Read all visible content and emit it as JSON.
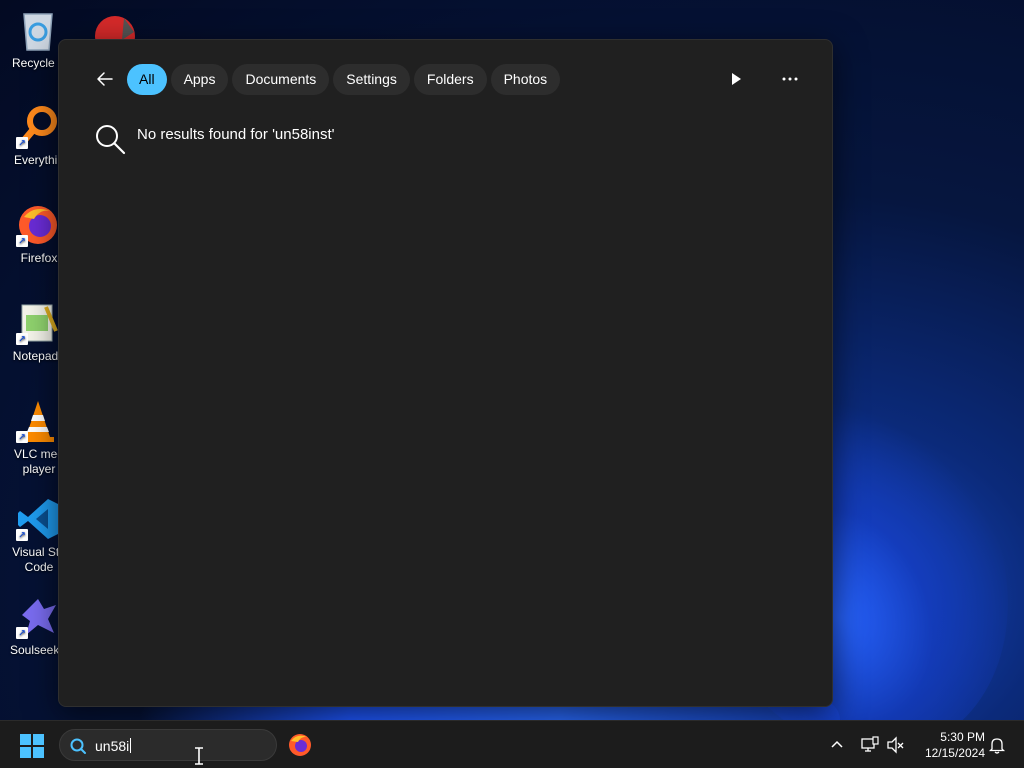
{
  "desktop": {
    "icons": [
      {
        "name": "recycle-bin",
        "label": "Recycle B"
      },
      {
        "name": "everything",
        "label": "Everythin"
      },
      {
        "name": "firefox",
        "label": "Firefox"
      },
      {
        "name": "notepad-plus-plus",
        "label": "Notepad+"
      },
      {
        "name": "vlc",
        "label": "VLC med\nplayer"
      },
      {
        "name": "visual-studio-code",
        "label": "Visual Stu\nCode"
      },
      {
        "name": "soulseek",
        "label": "SoulseekC"
      }
    ]
  },
  "search_panel": {
    "filters": [
      "All",
      "Apps",
      "Documents",
      "Settings",
      "Folders",
      "Photos"
    ],
    "active_filter": "All",
    "no_results_text": "No results found for 'un58inst'",
    "icons": {
      "back": "back-arrow-icon",
      "play": "play-icon",
      "more": "more-options-icon",
      "search": "search-icon"
    }
  },
  "taskbar": {
    "search_value": "un58i",
    "clock_time": "5:30 PM",
    "clock_date": "12/15/2024"
  },
  "colors": {
    "accent": "#4cc2ff",
    "panel_bg": "#202020",
    "chip_bg": "#2d2d2d",
    "taskbar_bg": "#1c1c1c"
  }
}
